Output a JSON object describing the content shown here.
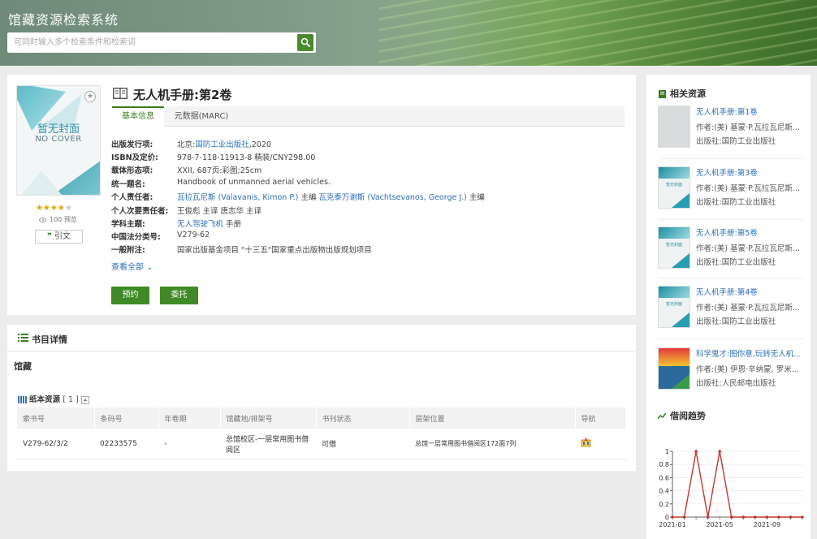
{
  "header": {
    "site_title": "馆藏资源检索系统",
    "search_placeholder": "可同时输入多个检索条件和检索词"
  },
  "cover": {
    "title_cn": "暂无封面",
    "title_en": "NO COVER"
  },
  "rating": {
    "stars_filled": 4,
    "stars_total": 5,
    "stars_display": "★★★★",
    "stars_empty": "★"
  },
  "views_text": "100 预览",
  "cite_label": "引文",
  "book": {
    "title": "无人机手册:第2卷"
  },
  "tabs": [
    {
      "label": "基本信息",
      "active": true
    },
    {
      "label": "元数据(MARC)",
      "active": false
    }
  ],
  "metadata": {
    "publish": {
      "label": "出版发行项:",
      "prefix": "北京:",
      "link": "国防工业出版社",
      "suffix": ",2020"
    },
    "isbn": {
      "label": "ISBN及定价:",
      "value": "978-7-118-11913-8 精装/CNY298.00"
    },
    "physical": {
      "label": "载体形态项:",
      "value": "XXII, 687页:彩图;25cm"
    },
    "uniform_title": {
      "label": "统一题名:",
      "value": "Handbook of unmanned aerial vehicles."
    },
    "author": {
      "label": "个人责任者:",
      "link1": "瓦拉瓦尼斯 (Valavanis, Kimon P.)",
      "mid": " 主编 ",
      "link2": "瓦克泰万谢斯 (Vachtsevanos, George J.)",
      "suffix": " 主编"
    },
    "secondary": {
      "label": "个人次要责任者:",
      "value": "王俊彪 主译 唐志华 主译"
    },
    "subject": {
      "label": "学科主题:",
      "link": "无人驾驶飞机",
      "suffix": " 手册"
    },
    "clc": {
      "label": "中国法分类号:",
      "value": "V279-62"
    },
    "note": {
      "label": "一般附注:",
      "value": "国家出版基金项目 \"十三五\"国家重点出版物出版规划项目"
    }
  },
  "show_all": "查看全部 ⌄",
  "buttons": {
    "reserve": "预约",
    "entrust": "委托"
  },
  "detail": {
    "section_title": "书目详情",
    "holdings_label": "馆藏",
    "paper_label": "纸本资源",
    "paper_count": "[ 1 ]",
    "columns": [
      "索书号",
      "条码号",
      "年卷期",
      "馆藏地/排架号",
      "书刊状态",
      "层架位置",
      "导航"
    ],
    "rows": [
      {
        "call_no": "V279-62/3/2",
        "barcode": "02233575",
        "volume": "-",
        "location": "总馆校区-一层常用图书借阅区",
        "status": "可借",
        "shelf": "总馆一层常用图书借阅区172面7列",
        "nav": ""
      }
    ]
  },
  "sidebar": {
    "related_title": "相关资源",
    "related": [
      {
        "title": "无人机手册:第1卷",
        "author": "作者:(美) 基蒙·P.瓦拉瓦尼斯...",
        "publisher": "出版社:国防工业出版社",
        "thumb": "gray"
      },
      {
        "title": "无人机手册:第3卷",
        "author": "作者:(美) 基蒙·P.瓦拉瓦尼斯...",
        "publisher": "出版社:国防工业出版社",
        "thumb": "cover"
      },
      {
        "title": "无人机手册:第5卷",
        "author": "作者:(美) 基蒙·P.瓦拉瓦尼斯...",
        "publisher": "出版社:国防工业出版社",
        "thumb": "cover"
      },
      {
        "title": "无人机手册:第4卷",
        "author": "作者:(美) 基蒙·P.瓦拉瓦尼斯...",
        "publisher": "出版社:国防工业出版社",
        "thumb": "cover"
      },
      {
        "title": "科学鬼才:图你意,玩转无人机...",
        "author": "作者:(美) 伊恩·辛纳蒙, 罗米...",
        "publisher": "出版社:人民邮电出版社",
        "thumb": "colorful"
      }
    ],
    "thumb_text": "暂无封面",
    "trend_title": "借阅趋势"
  },
  "chart_data": {
    "type": "line",
    "title": "",
    "xlabel": "",
    "ylabel": "",
    "x_ticks": [
      "2021-01",
      "2021-05",
      "2021-09"
    ],
    "y_ticks": [
      "0",
      "0.2",
      "0.4",
      "0.6",
      "0.8",
      "1"
    ],
    "ylim": [
      0,
      1
    ],
    "x": [
      "2021-01",
      "2021-02",
      "2021-03",
      "2021-04",
      "2021-05",
      "2021-06",
      "2021-07",
      "2021-08",
      "2021-09",
      "2021-10",
      "2021-11",
      "2021-12"
    ],
    "series": [
      {
        "values": [
          0,
          0,
          1,
          0,
          1,
          0,
          0,
          0,
          0,
          0,
          0,
          0
        ]
      }
    ],
    "color": "#c0392b",
    "grid": true
  }
}
